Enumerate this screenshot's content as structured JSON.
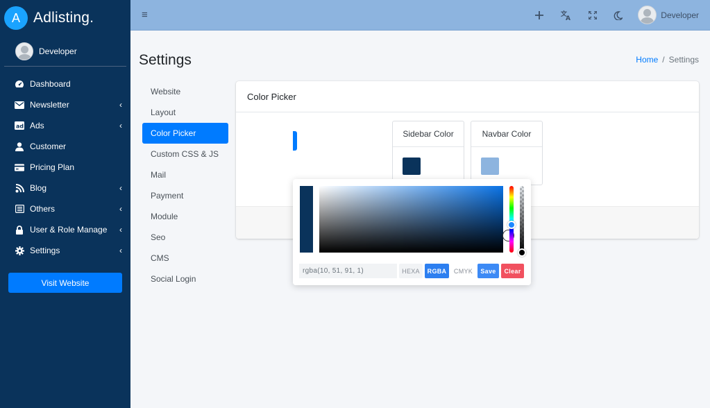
{
  "sidebar": {
    "brand": {
      "logo_letter": "A",
      "name": "Adlisting."
    },
    "user": {
      "name": "Developer"
    },
    "items": [
      {
        "label": "Dashboard",
        "icon": "dashboard-icon",
        "has_submenu": false
      },
      {
        "label": "Newsletter",
        "icon": "envelope-icon",
        "has_submenu": true
      },
      {
        "label": "Ads",
        "icon": "ad-icon",
        "has_submenu": true
      },
      {
        "label": "Customer",
        "icon": "user-icon",
        "has_submenu": false
      },
      {
        "label": "Pricing Plan",
        "icon": "credit-card-icon",
        "has_submenu": false
      },
      {
        "label": "Blog",
        "icon": "blog-icon",
        "has_submenu": true
      },
      {
        "label": "Others",
        "icon": "list-icon",
        "has_submenu": true
      },
      {
        "label": "User & Role Manage",
        "icon": "lock-icon",
        "has_submenu": true
      },
      {
        "label": "Settings",
        "icon": "gear-icon",
        "has_submenu": true
      }
    ],
    "visit_button": "Visit Website",
    "background_color": "#0a335b"
  },
  "topbar": {
    "menu_icon": "hamburger-icon",
    "icons": [
      "plus-icon",
      "translate-icon",
      "expand-icon",
      "moon-icon"
    ],
    "user_name": "Developer",
    "background_color": "#8db4df"
  },
  "header": {
    "title": "Settings",
    "breadcrumb": {
      "home": "Home",
      "current": "Settings"
    }
  },
  "settings_menu": {
    "items": [
      "Website",
      "Layout",
      "Color Picker",
      "Custom CSS & JS",
      "Mail",
      "Payment",
      "Module",
      "Seo",
      "CMS",
      "Social Login"
    ],
    "active": "Color Picker"
  },
  "card": {
    "title": "Color Picker",
    "sidebar_color": {
      "label": "Sidebar Color",
      "value": "#0a335b"
    },
    "navbar_color": {
      "label": "Navbar Color",
      "value": "#8db4df"
    }
  },
  "picker": {
    "value": "rgba(10, 51, 91, 1)",
    "modes": {
      "hexa": "HEXA",
      "rgba": "RGBA",
      "cmyk": "CMYK"
    },
    "active_mode": "RGBA",
    "save_label": "Save",
    "clear_label": "Clear"
  }
}
